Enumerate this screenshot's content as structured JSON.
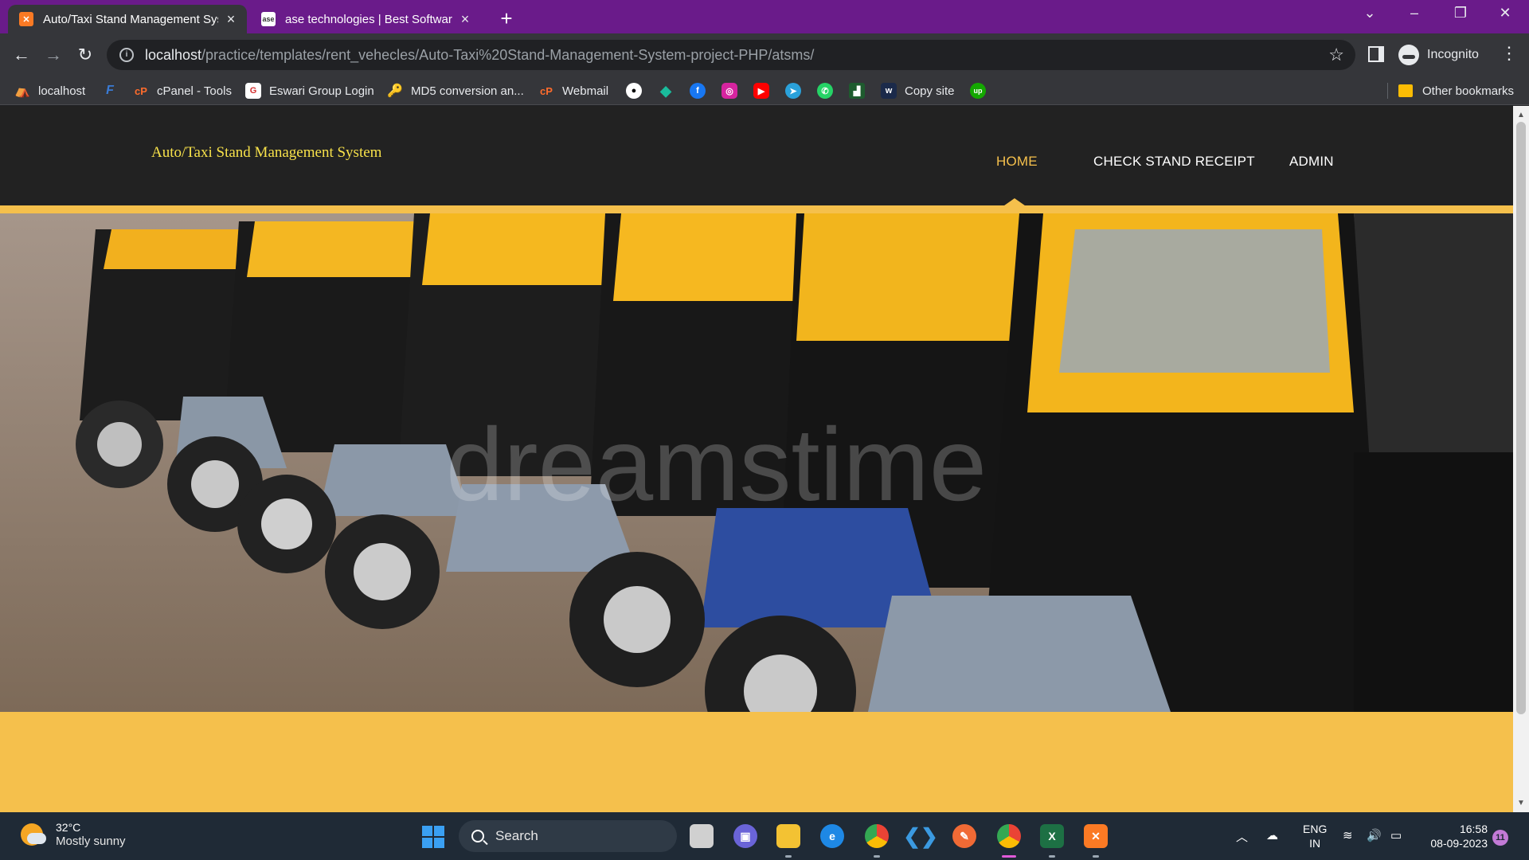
{
  "browser": {
    "tabs": [
      {
        "title": "Auto/Taxi Stand Management System",
        "favicon": "xampp-icon",
        "active": true
      },
      {
        "title": "ase technologies | Best Software Company",
        "favicon": "ase-icon",
        "active": false
      }
    ],
    "new_tab_label": "+",
    "url_host": "localhost",
    "url_path": "/practice/templates/rent_vehecles/Auto-Taxi%20Stand-Management-System-project-PHP/atsms/",
    "profile_label": "Incognito",
    "bookmarks": [
      {
        "label": "localhost",
        "icon": "localhost-icon"
      },
      {
        "label": "",
        "icon": "f-icon"
      },
      {
        "label": "cPanel - Tools",
        "icon": "cpanel-icon"
      },
      {
        "label": "Eswari Group Login",
        "icon": "eswari-icon"
      },
      {
        "label": "MD5 conversion an...",
        "icon": "md5-icon"
      },
      {
        "label": "Webmail",
        "icon": "cpanel-webmail-icon"
      },
      {
        "label": "Copy site",
        "icon": "w-icon"
      }
    ],
    "other_bookmarks": "Other bookmarks"
  },
  "site": {
    "brand": "Auto/Taxi Stand Management System",
    "nav": [
      {
        "label": "HOME",
        "active": true
      },
      {
        "label": "CHECK STAND RECEIPT",
        "active": false
      },
      {
        "label": "ADMIN",
        "active": false
      }
    ],
    "hero_watermark": "dreamstime",
    "colors": {
      "header_bg": "#222222",
      "accent": "#f5c04c",
      "brand_text": "#f7e14a"
    }
  },
  "taskbar": {
    "temperature": "32°C",
    "weather": "Mostly sunny",
    "search_placeholder": "Search",
    "lang_line1": "ENG",
    "lang_line2": "IN",
    "time": "16:58",
    "date": "08-09-2023",
    "notification_count": "11"
  }
}
